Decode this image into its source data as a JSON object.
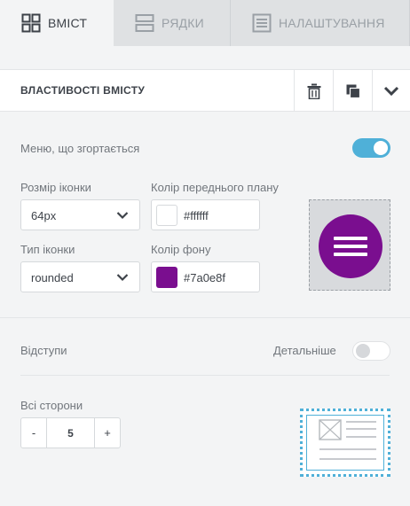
{
  "tabs": [
    {
      "label": "ВМІСТ",
      "icon": "grid-icon",
      "active": true
    },
    {
      "label": "РЯДКИ",
      "icon": "rows-icon",
      "active": false
    },
    {
      "label": "НАЛАШТУВАННЯ",
      "icon": "settings-panel-icon",
      "active": false
    }
  ],
  "properties": {
    "title": "ВЛАСТИВОСТІ ВМІСТУ"
  },
  "collapsible_menu": {
    "label": "Меню, що згортається",
    "enabled": true,
    "toggle_color": "#4fb0d8"
  },
  "icon_size": {
    "label": "Розмір іконки",
    "value": "64px"
  },
  "foreground_color": {
    "label": "Колір переднього плану",
    "value": "#ffffff"
  },
  "icon_type": {
    "label": "Тип іконки",
    "value": "rounded"
  },
  "background_color": {
    "label": "Колір фону",
    "value": "#7a0e8f"
  },
  "padding": {
    "label": "Відступи",
    "details_label": "Детальніше",
    "details_enabled": false,
    "all_sides_label": "Всі сторони",
    "value": "5",
    "minus": "-",
    "plus": "+"
  }
}
